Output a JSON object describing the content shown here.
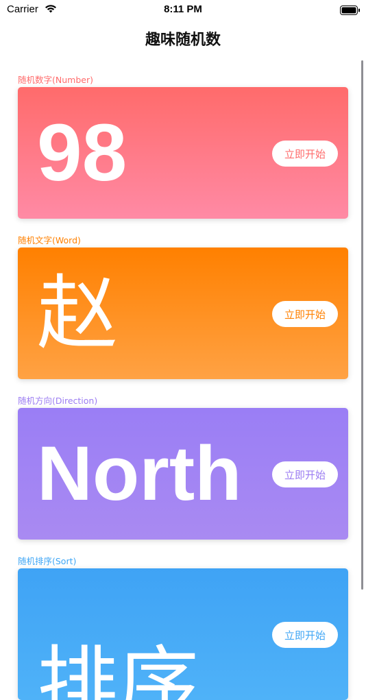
{
  "status_bar": {
    "carrier": "Carrier",
    "time": "8:11 PM"
  },
  "nav": {
    "title": "趣味随机数"
  },
  "sections": [
    {
      "label": "随机数字(Number)",
      "value": "98",
      "button_label": "立即开始",
      "label_color": "#ff6b6b",
      "gradient_top": "#ff6b6b",
      "gradient_bottom": "#ff8aa5"
    },
    {
      "label": "随机文字(Word)",
      "value": "赵",
      "button_label": "立即开始",
      "label_color": "#ff8000",
      "gradient_top": "#ff8000",
      "gradient_bottom": "#ffa244"
    },
    {
      "label": "随机方向(Direction)",
      "value": "North",
      "button_label": "立即开始",
      "label_color": "#9b7cf2",
      "gradient_top": "#9a7ef5",
      "gradient_bottom": "#a98af2"
    },
    {
      "label": "随机排序(Sort)",
      "value": "排序",
      "button_label": "立即开始",
      "label_color": "#3fa6f5",
      "gradient_top": "#3fa3f5",
      "gradient_bottom": "#4fb2f8"
    }
  ]
}
